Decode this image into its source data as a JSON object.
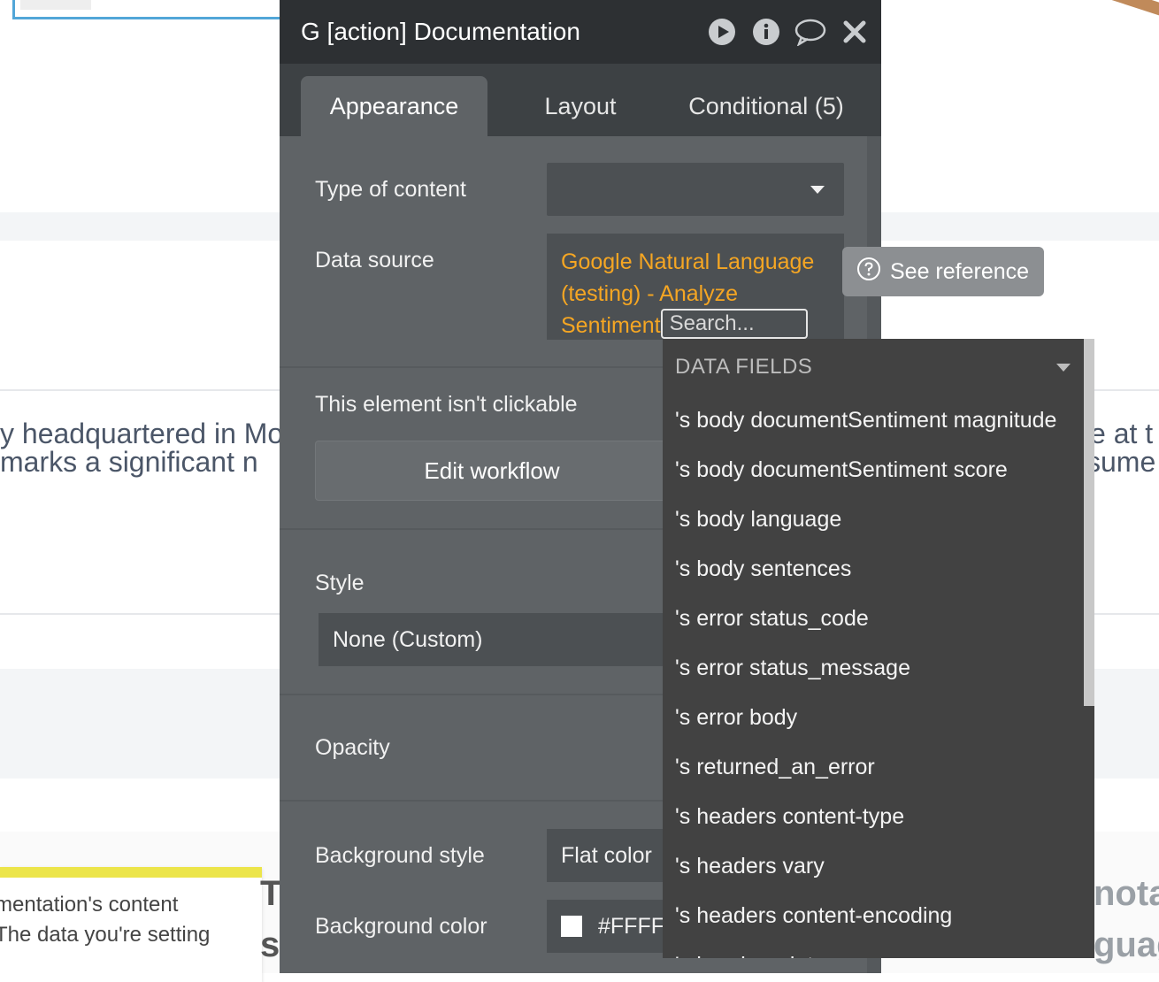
{
  "panel": {
    "title": "G [action] Documentation",
    "icons": [
      "play-icon",
      "info-icon",
      "comment-icon",
      "close-icon"
    ]
  },
  "tabs": [
    {
      "label": "Appearance",
      "active": true
    },
    {
      "label": "Layout",
      "active": false
    },
    {
      "label": "Conditional (5)",
      "active": false
    }
  ],
  "properties": {
    "type_of_content_label": "Type of content",
    "type_of_content_value": "",
    "data_source_label": "Data source",
    "data_source_value": "Google Natural Language (testing) - Analyze Sentiment",
    "data_source_line1": "Google Natural Language",
    "data_source_line2": "(testing) - Analyze",
    "data_source_line3": "Sentiment",
    "search_placeholder": "Search...",
    "see_reference": "See reference",
    "clickable_label": "This element isn't clickable",
    "edit_workflow": "Edit workflow",
    "style_label": "Style",
    "style_value": "None (Custom)",
    "opacity_label": "Opacity",
    "background_style_label": "Background style",
    "background_style_value": "Flat color",
    "background_color_label": "Background color",
    "background_color_value": "#FFFFF"
  },
  "data_fields": {
    "header": "DATA FIELDS",
    "items": [
      "'s body documentSentiment magnitude",
      "'s body documentSentiment score",
      "'s body language",
      "'s body sentences",
      "'s error status_code",
      "'s error status_message",
      "'s error body",
      "'s returned_an_error",
      "'s headers content-type",
      "'s headers vary",
      "'s headers content-encoding",
      "'s headers date"
    ]
  },
  "background_page": {
    "line1_left": "y headquartered in Mo",
    "line2_left": " marks a significant n",
    "line1_right": "e at t",
    "line2_right": "sume",
    "card_line1": "mentation's content",
    "card_line2": "The data you're setting",
    "bold_left_1": "To",
    "bold_left_2": "s",
    "gray_right_1": "nota",
    "gray_right_2": "guag"
  },
  "colors": {
    "panel_bg": "#5f6366",
    "title_bg": "#2d3033",
    "accent_orange": "#f5a623",
    "dropdown_bg": "#424242"
  }
}
